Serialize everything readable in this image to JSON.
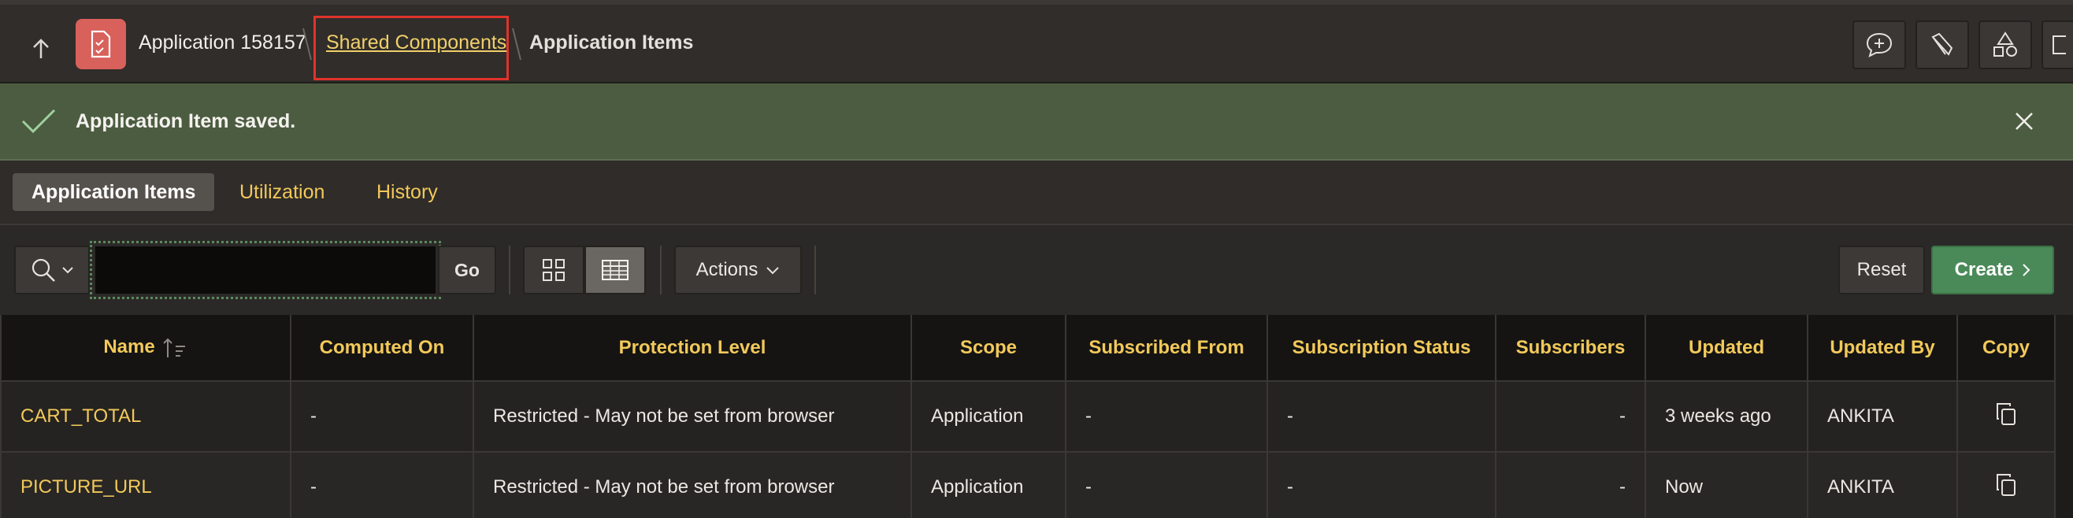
{
  "header": {
    "app_label": "Application 158157",
    "shared_components": "Shared Components",
    "current_page": "Application Items"
  },
  "banner": {
    "message": "Application Item saved."
  },
  "tabs": [
    {
      "label": "Application Items",
      "active": true
    },
    {
      "label": "Utilization",
      "active": false
    },
    {
      "label": "History",
      "active": false
    }
  ],
  "toolbar": {
    "search_value": "",
    "go_label": "Go",
    "actions_label": "Actions",
    "reset_label": "Reset",
    "create_label": "Create"
  },
  "table": {
    "columns": [
      "Name",
      "Computed On",
      "Protection Level",
      "Scope",
      "Subscribed From",
      "Subscription Status",
      "Subscribers",
      "Updated",
      "Updated By",
      "Copy"
    ],
    "rows": [
      {
        "name": "CART_TOTAL",
        "computed_on": "-",
        "protection_level": "Restricted - May not be set from browser",
        "scope": "Application",
        "subscribed_from": "-",
        "subscription_status": "-",
        "subscribers": "-",
        "updated": "3 weeks ago",
        "updated_by": "ANKITA"
      },
      {
        "name": "PICTURE_URL",
        "computed_on": "-",
        "protection_level": "Restricted - May not be set from browser",
        "scope": "Application",
        "subscribed_from": "-",
        "subscription_status": "-",
        "subscribers": "-",
        "updated": "Now",
        "updated_by": "ANKITA"
      }
    ]
  },
  "colors": {
    "accent_yellow": "#f2c95a",
    "success_banner": "#4c5c40",
    "create_green": "#4a8a58",
    "highlight_red": "#e0332b"
  }
}
